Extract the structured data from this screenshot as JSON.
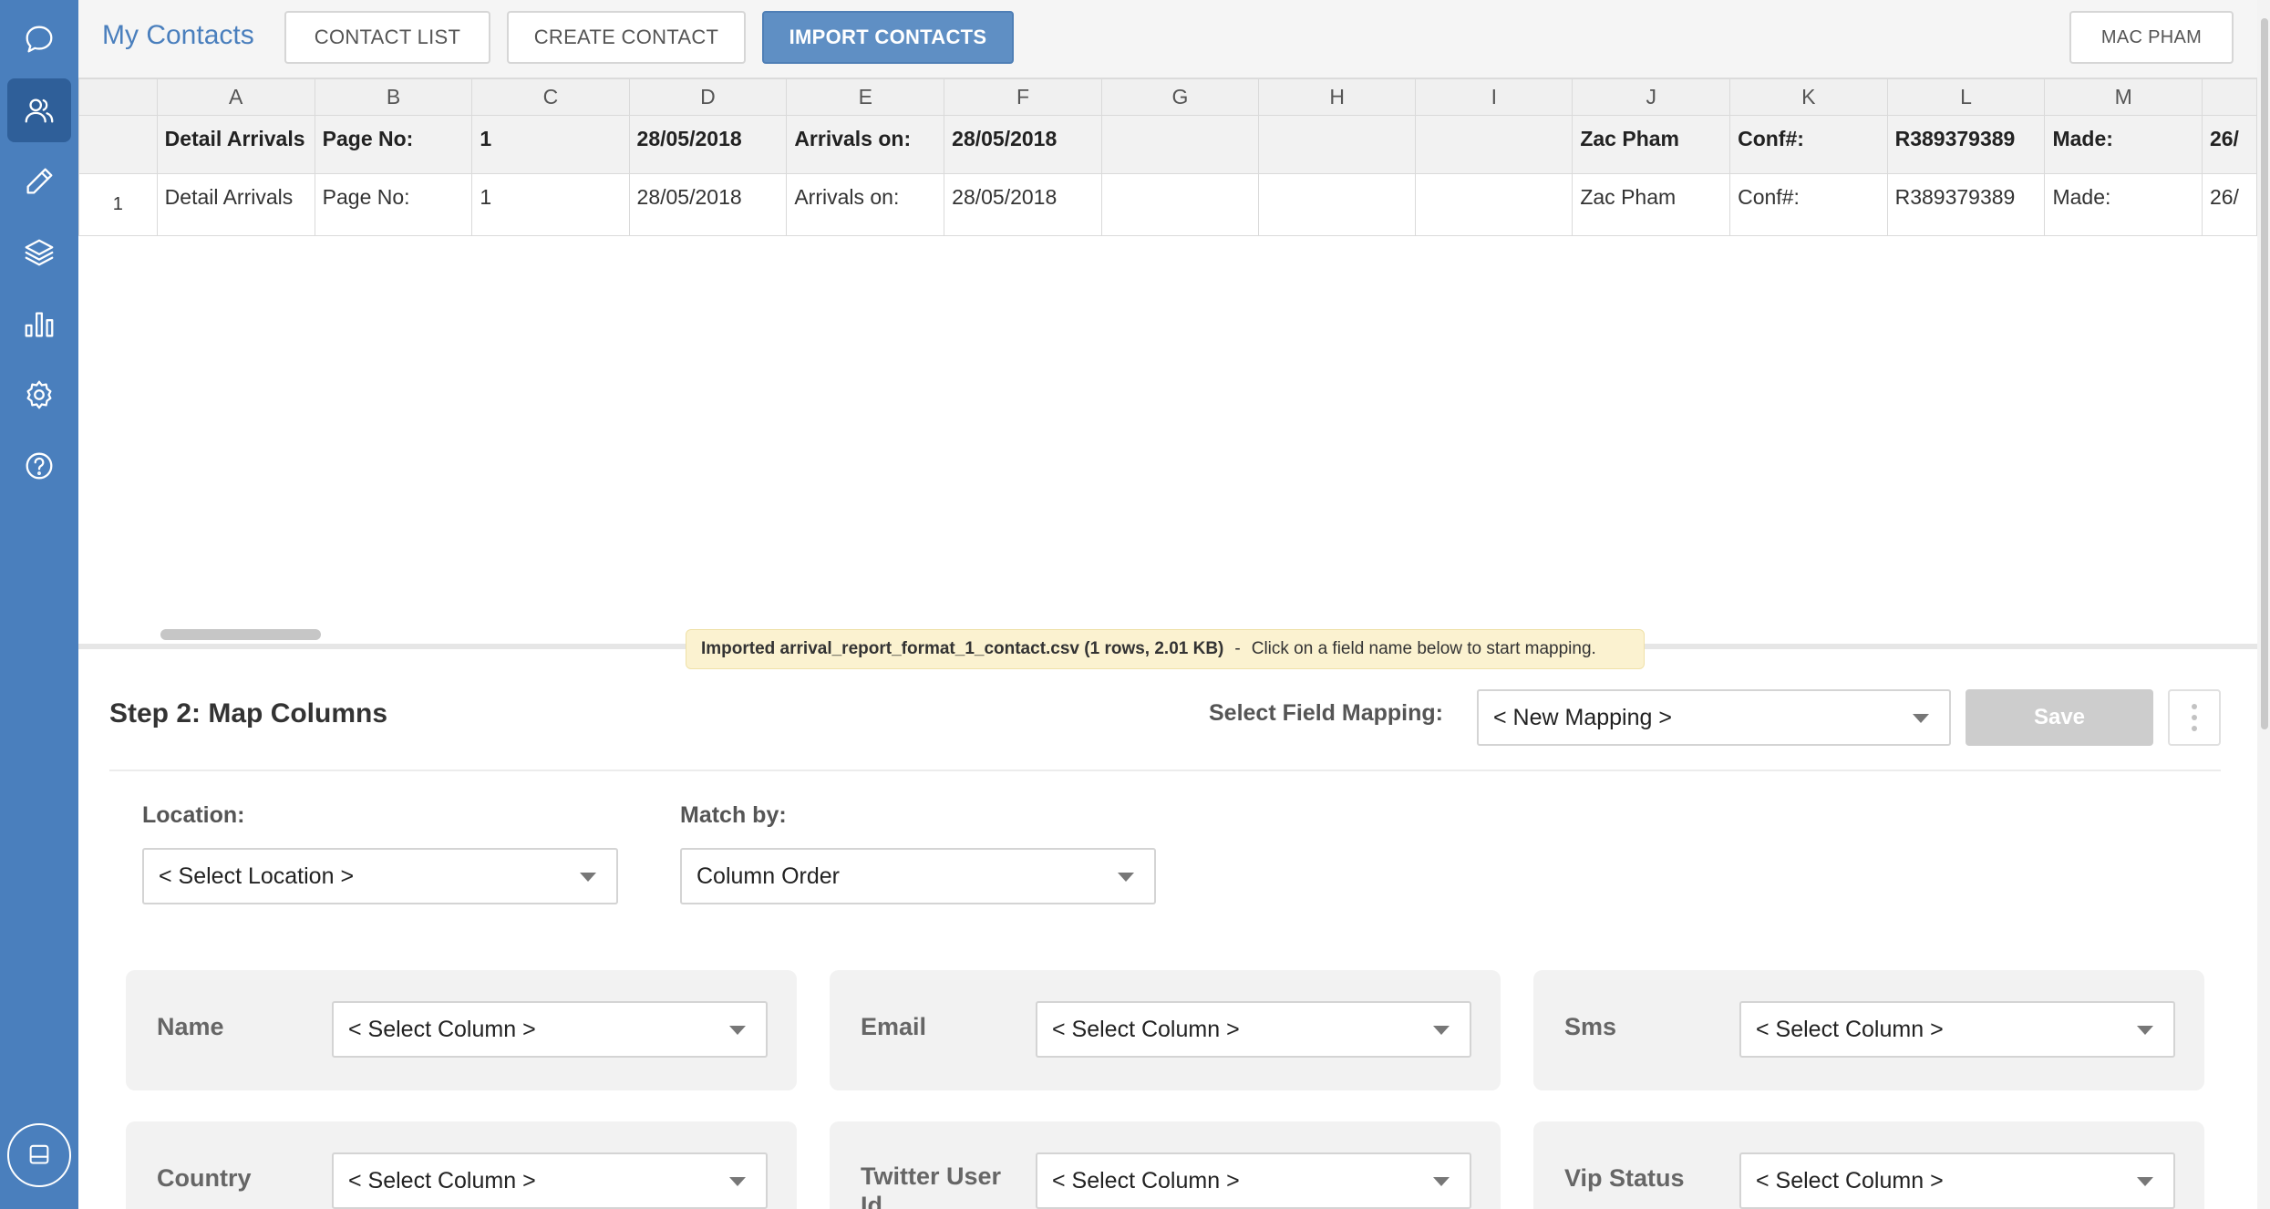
{
  "app": {
    "title": "My Contacts"
  },
  "topbar": {
    "contact_list": "CONTACT LIST",
    "create_contact": "CREATE CONTACT",
    "import_contacts": "IMPORT CONTACTS",
    "user": "MAC PHAM"
  },
  "sidebar": {
    "items": [
      {
        "icon": "chat-icon"
      },
      {
        "icon": "contacts-icon",
        "active": true
      },
      {
        "icon": "pencil-icon"
      },
      {
        "icon": "layers-icon"
      },
      {
        "icon": "chart-icon"
      },
      {
        "icon": "gear-icon"
      },
      {
        "icon": "help-icon"
      }
    ],
    "bottom_icon": "messenger-icon"
  },
  "grid": {
    "columns": [
      "A",
      "B",
      "C",
      "D",
      "E",
      "F",
      "G",
      "H",
      "I",
      "J",
      "K",
      "L",
      "M"
    ],
    "header_row": [
      "Detail Arrivals",
      "Page No:",
      "1",
      "28/05/2018",
      "Arrivals on:",
      "28/05/2018",
      "",
      "",
      "",
      "Zac Pham",
      "Conf#:",
      "R389379389",
      "Made:",
      "26/"
    ],
    "rows": [
      {
        "num": "1",
        "cells": [
          "Detail Arrivals",
          "Page No:",
          "1",
          "28/05/2018",
          "Arrivals on:",
          "28/05/2018",
          "",
          "",
          "",
          "Zac Pham",
          "Conf#:",
          "R389379389",
          "Made:",
          "26/"
        ]
      }
    ]
  },
  "toast": {
    "file": "Imported arrival_report_format_1_contact.csv (1 rows, 2.01 KB)",
    "separator": "-",
    "hint": "Click on a field name below to start mapping."
  },
  "mapping": {
    "step_title": "Step 2: Map Columns",
    "select_label": "Select Field Mapping:",
    "selected_mapping": "< New Mapping >",
    "save_label": "Save",
    "location_label": "Location:",
    "location_value": "< Select Location >",
    "match_label": "Match by:",
    "match_value": "Column Order",
    "fields": [
      {
        "label": "Name",
        "value": "< Select Column >"
      },
      {
        "label": "Email",
        "value": "< Select Column >"
      },
      {
        "label": "Sms",
        "value": "< Select Column >"
      },
      {
        "label": "Country",
        "value": "< Select Column >"
      },
      {
        "label": "Twitter User Id",
        "value": "< Select Column >"
      },
      {
        "label": "Vip Status",
        "value": "< Select Column >"
      }
    ]
  },
  "colors": {
    "sidebar": "#4a7fbd",
    "accent": "#5f8fc4",
    "toast": "#fbf2d0"
  }
}
